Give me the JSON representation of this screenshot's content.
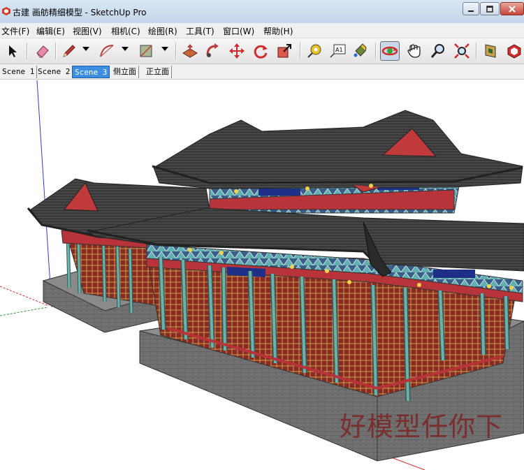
{
  "window": {
    "title": "古建 画舫精细模型 - SketchUp Pro"
  },
  "menu": {
    "items": [
      "文件(F)",
      "编辑(E)",
      "视图(V)",
      "相机(C)",
      "绘图(R)",
      "工具(T)",
      "窗口(W)",
      "帮助(H)"
    ]
  },
  "toolbar": {
    "tools": [
      "select-icon",
      "eraser-icon",
      "pencil-icon",
      "arc-icon",
      "rectangle-icon",
      "push-pull-icon",
      "follow-me-icon",
      "move-icon",
      "rotate-icon",
      "scale-icon",
      "tape-measure-icon",
      "text-icon",
      "paint-bucket-icon",
      "orbit-icon",
      "pan-icon",
      "zoom-icon",
      "zoom-extents-icon",
      "section-plane-icon",
      "components-icon"
    ],
    "text_tool_label": "A1"
  },
  "scenes": {
    "tabs": [
      "Scene 1",
      "Scene 2",
      "Scene 3",
      "侧立面",
      "正立面"
    ],
    "active_index": 2
  },
  "viewport": {
    "watermark": "好模型任你下"
  },
  "colors": {
    "roof": "#3d3d3d",
    "gable_red": "#c0393b",
    "column_teal": "#5f9c98",
    "wall_red": "#a0302a",
    "platform_gray": "#6b6b6b",
    "axis_blue": "#2d3bd6",
    "axis_red": "#d33030",
    "axis_green": "#3a9a3a",
    "active_tab": "#3c8fe0"
  }
}
